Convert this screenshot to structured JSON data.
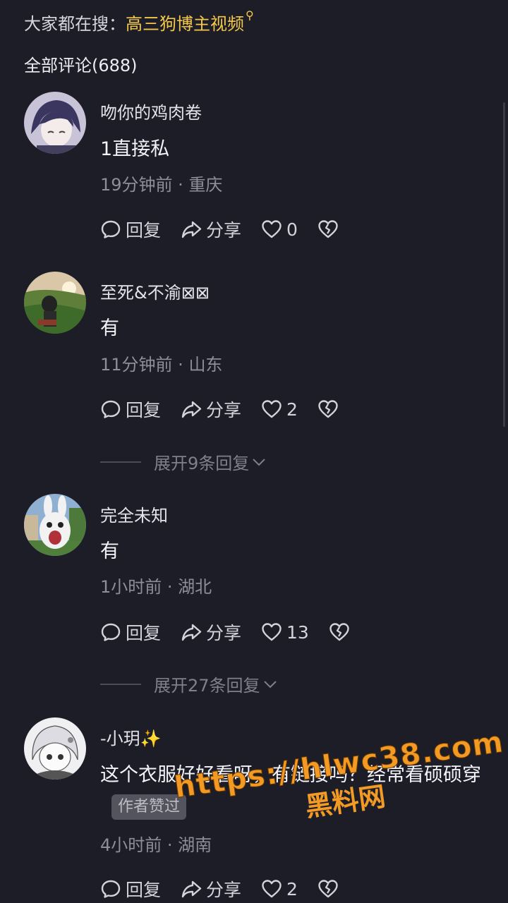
{
  "search_hint": {
    "prefix": "大家都在搜：",
    "keyword": "高三狗博主视频"
  },
  "comments_title": "全部评论(688)",
  "actions": {
    "reply": "回复",
    "share": "分享"
  },
  "comments": [
    {
      "username": "吻你的鸡肉卷",
      "text": "1直接私",
      "time": "19分钟前",
      "location": "重庆",
      "likes": "0",
      "expand": ""
    },
    {
      "username": "至死&不渝⊠⊠",
      "text": "有",
      "time": "11分钟前",
      "location": "山东",
      "likes": "2",
      "expand": "展开9条回复"
    },
    {
      "username": "完全未知",
      "text": "有",
      "time": "1小时前",
      "location": "湖北",
      "likes": "13",
      "expand": "展开27条回复"
    },
    {
      "username": "-小玥✨",
      "text": "这个衣服好好看呀，有链接吗？经常看硕硕穿",
      "badge": "作者赞过",
      "time": "4小时前",
      "location": "湖南",
      "likes": "2",
      "expand": ""
    }
  ],
  "watermark": {
    "url": "https://hlwc38.com",
    "label": "黑料网"
  }
}
